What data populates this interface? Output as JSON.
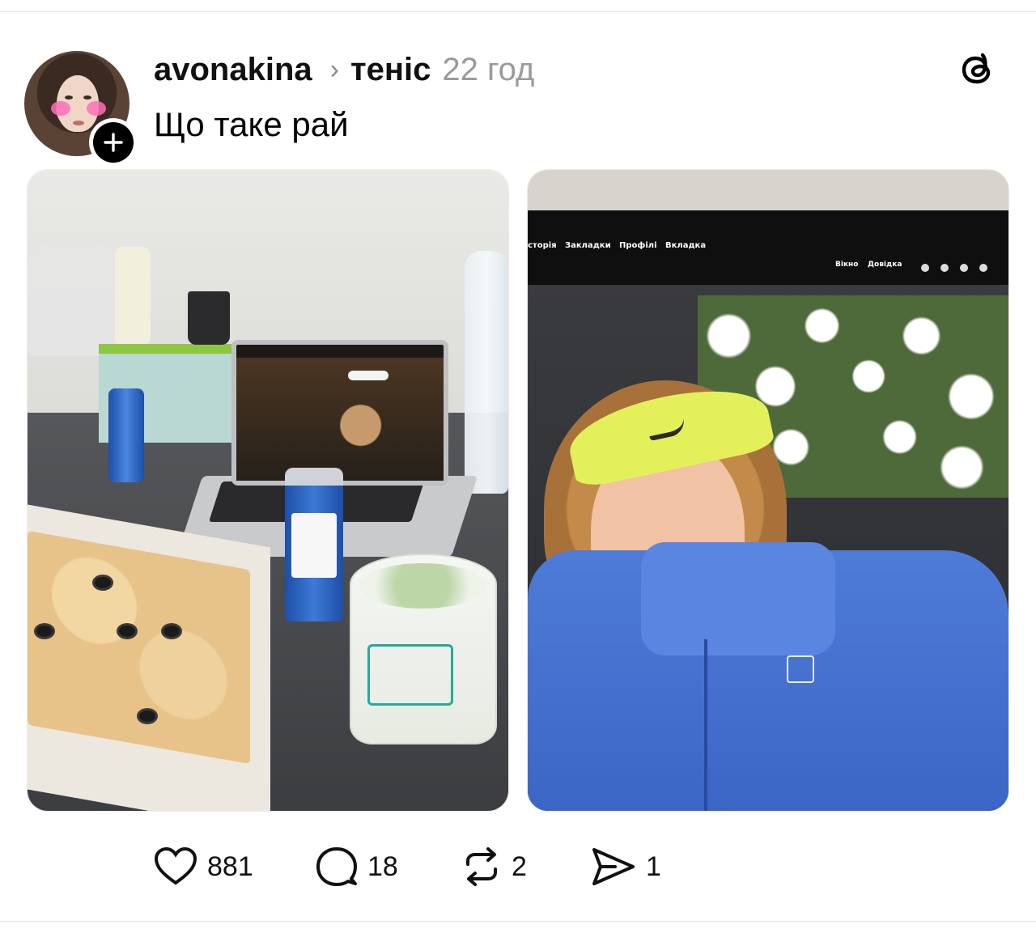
{
  "post": {
    "author": {
      "username": "avonakina"
    },
    "topic": "теніс",
    "time": "22 год",
    "text": "Що таке рай"
  },
  "media": {
    "image_1": {
      "screen_menu": []
    },
    "image_2": {
      "menu_items": [
        "сторія",
        "Закладки",
        "Профілі",
        "Вкладка"
      ],
      "menu_right": [
        "Вікно",
        "Довідка"
      ]
    }
  },
  "actions": {
    "likes": "881",
    "comments": "18",
    "reposts": "2",
    "shares": "1"
  },
  "icons": {
    "like": "heart-icon",
    "comment": "comment-bubble-icon",
    "repost": "repost-icon",
    "share": "share-send-icon",
    "app": "threads-logo-icon",
    "follow": "plus-icon"
  }
}
